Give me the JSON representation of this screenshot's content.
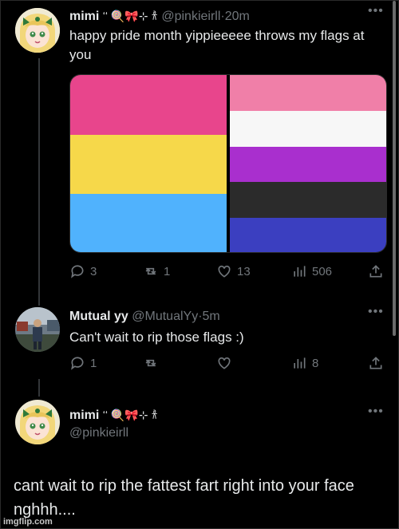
{
  "tweet1": {
    "display_name": "mimi",
    "name_emojis": "ʻʻ 🍭🎀⊹ 𐀪",
    "handle": "@pinkieirll",
    "dot": "·",
    "time": "20m",
    "text": "happy pride month yippieeeee throws my flags at you",
    "flag_left_colors": [
      "#e8458c",
      "#f6d84a",
      "#50b2fd"
    ],
    "flag_right_colors": [
      "#f07fa8",
      "#f7f7f7",
      "#a92fce",
      "#2b2b2b",
      "#3b3fc0"
    ],
    "stats": {
      "replies": "3",
      "retweets": "1",
      "likes": "13",
      "views": "506"
    }
  },
  "tweet2": {
    "display_name": "Mutual yy",
    "handle": "@MutualYy",
    "dot": "·",
    "time": "5m",
    "text": "Can't wait to rip those flags :)",
    "stats": {
      "replies": "1",
      "retweets": "",
      "likes": "",
      "views": "8"
    }
  },
  "tweet3": {
    "display_name": "mimi",
    "name_emojis": "ʻʻ 🍭🎀⊹ 𐀪",
    "handle": "@pinkieirll",
    "text": "cant wait to rip the fattest fart right into your face nghhh...."
  },
  "colors": {
    "background": "#000000",
    "text": "#e7e9ea",
    "muted": "#71767b"
  },
  "icons": [
    "more-icon",
    "reply-icon",
    "retweet-icon",
    "like-icon",
    "views-icon",
    "share-icon"
  ],
  "watermark": "imgflip.com"
}
